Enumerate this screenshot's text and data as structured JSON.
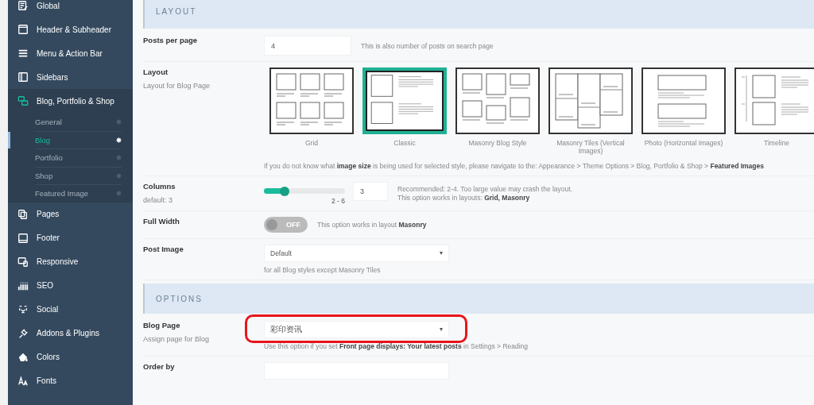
{
  "sidebar": {
    "items": [
      {
        "label": "Global",
        "expanded": false
      },
      {
        "label": "Header & Subheader",
        "expanded": false
      },
      {
        "label": "Menu & Action Bar",
        "expanded": false
      },
      {
        "label": "Sidebars",
        "expanded": false
      },
      {
        "label": "Blog, Portfolio & Shop",
        "expanded": true,
        "children": [
          {
            "label": "General",
            "selected": false
          },
          {
            "label": "Blog",
            "selected": true
          },
          {
            "label": "Portfolio",
            "selected": false
          },
          {
            "label": "Shop",
            "selected": false
          },
          {
            "label": "Featured Image",
            "selected": false
          }
        ]
      },
      {
        "label": "Pages",
        "expanded": false
      },
      {
        "label": "Footer",
        "expanded": false
      },
      {
        "label": "Responsive",
        "expanded": false
      },
      {
        "label": "SEO",
        "expanded": false
      },
      {
        "label": "Social",
        "expanded": false
      },
      {
        "label": "Addons & Plugins",
        "expanded": false
      },
      {
        "label": "Colors",
        "expanded": false
      },
      {
        "label": "Fonts",
        "expanded": false
      }
    ]
  },
  "layout_section": {
    "title": "LAYOUT",
    "posts_per_page": {
      "label": "Posts per page",
      "value": "4",
      "note": "This is also number of posts on search page"
    },
    "layout": {
      "label": "Layout",
      "description": "Layout for Blog Page",
      "options": [
        {
          "kind": "grid",
          "caption": "Grid",
          "selected": false
        },
        {
          "kind": "classic",
          "caption": "Classic",
          "selected": true
        },
        {
          "kind": "masonry",
          "caption": "Masonry Blog Style",
          "selected": false
        },
        {
          "kind": "tiles",
          "caption": "Masonry Tiles (Vertical Images)",
          "selected": false
        },
        {
          "kind": "photo",
          "caption": "Photo (Horizontal Images)",
          "selected": false
        },
        {
          "kind": "timeline",
          "caption": "Timeline",
          "selected": false
        }
      ],
      "note": "If you do not know what **image size** is being used for selected style, please navigate to the: Appearance > Theme Options > Blog, Portfolio & Shop > **Featured Images**"
    },
    "columns": {
      "label": "Columns",
      "description": "default: 3",
      "level": 0.25,
      "range": "2 - 6",
      "value": "3",
      "note_1": "Recommended: 2-4. Too large value may crash the layout.",
      "note_2": "This option works in layouts: **Grid, Masonry**"
    },
    "full_width": {
      "label": "Full Width",
      "on": false,
      "toggle_text": "OFF",
      "note": "This option works in layout **Masonry**"
    },
    "post_image": {
      "label": "Post Image",
      "value": "Default",
      "note": "for all Blog styles except Masonry Tiles"
    }
  },
  "options_section": {
    "title": "OPTIONS",
    "blog_page": {
      "label": "Blog Page",
      "description": "Assign page for Blog",
      "value": "彩印资讯",
      "highlighted": true,
      "note": "Use this option if you set **Front page displays: Your latest posts** in Settings > Reading"
    },
    "order_by": {
      "label": "Order by"
    }
  }
}
